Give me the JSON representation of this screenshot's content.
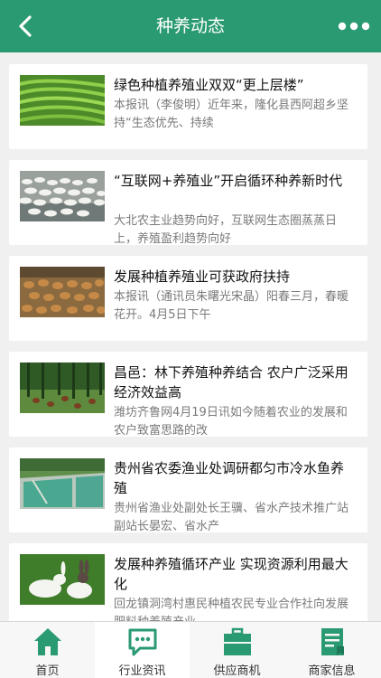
{
  "header": {
    "title": "种养动态"
  },
  "articles": [
    {
      "title": "绿色种植养殖业双双“更上层楼”",
      "desc": "本报讯（李俊明）近年来，隆化县西阿超乡坚持“生态优先、持续",
      "image": "tea-terraces"
    },
    {
      "title": "“互联网+养殖业”开启循环种养新时代",
      "desc": "大北农主业趋势向好，互联网生态圈蒸蒸日上，养殖盈利趋势向好",
      "image": "goose-flock"
    },
    {
      "title": "发展种植养殖业可获政府扶持",
      "desc": "本报讯（通讯员朱曙光宋晶）阳春三月，春暖花开。4月5日下午",
      "image": "duck-farm"
    },
    {
      "title": "昌邑：林下养殖种养结合 农户广泛采用经济效益高",
      "desc": "潍坊齐鲁网4月19日讯如今随着农业的发展和农户致富思路的改",
      "image": "forest-chickens"
    },
    {
      "title": "贵州省农委渔业处调研都匀市冷水鱼养殖",
      "desc": "贵州省渔业处副处长王骥、省水产技术推广站副站长晏宏、省水产",
      "image": "fish-ponds"
    },
    {
      "title": "发展种养殖循环产业 实现资源利用最大化",
      "desc": "回龙镇洞湾村惠民种植农民专业合作社向发展肥料种养殖产业",
      "image": "rabbits"
    }
  ],
  "tabs": [
    {
      "label": "首页",
      "icon": "home-icon"
    },
    {
      "label": "行业资讯",
      "icon": "chat-icon"
    },
    {
      "label": "供应商机",
      "icon": "briefcase-icon"
    },
    {
      "label": "商家信息",
      "icon": "document-icon"
    }
  ],
  "colors": {
    "brand": "#2a9a72",
    "background": "#f0f0f0"
  }
}
